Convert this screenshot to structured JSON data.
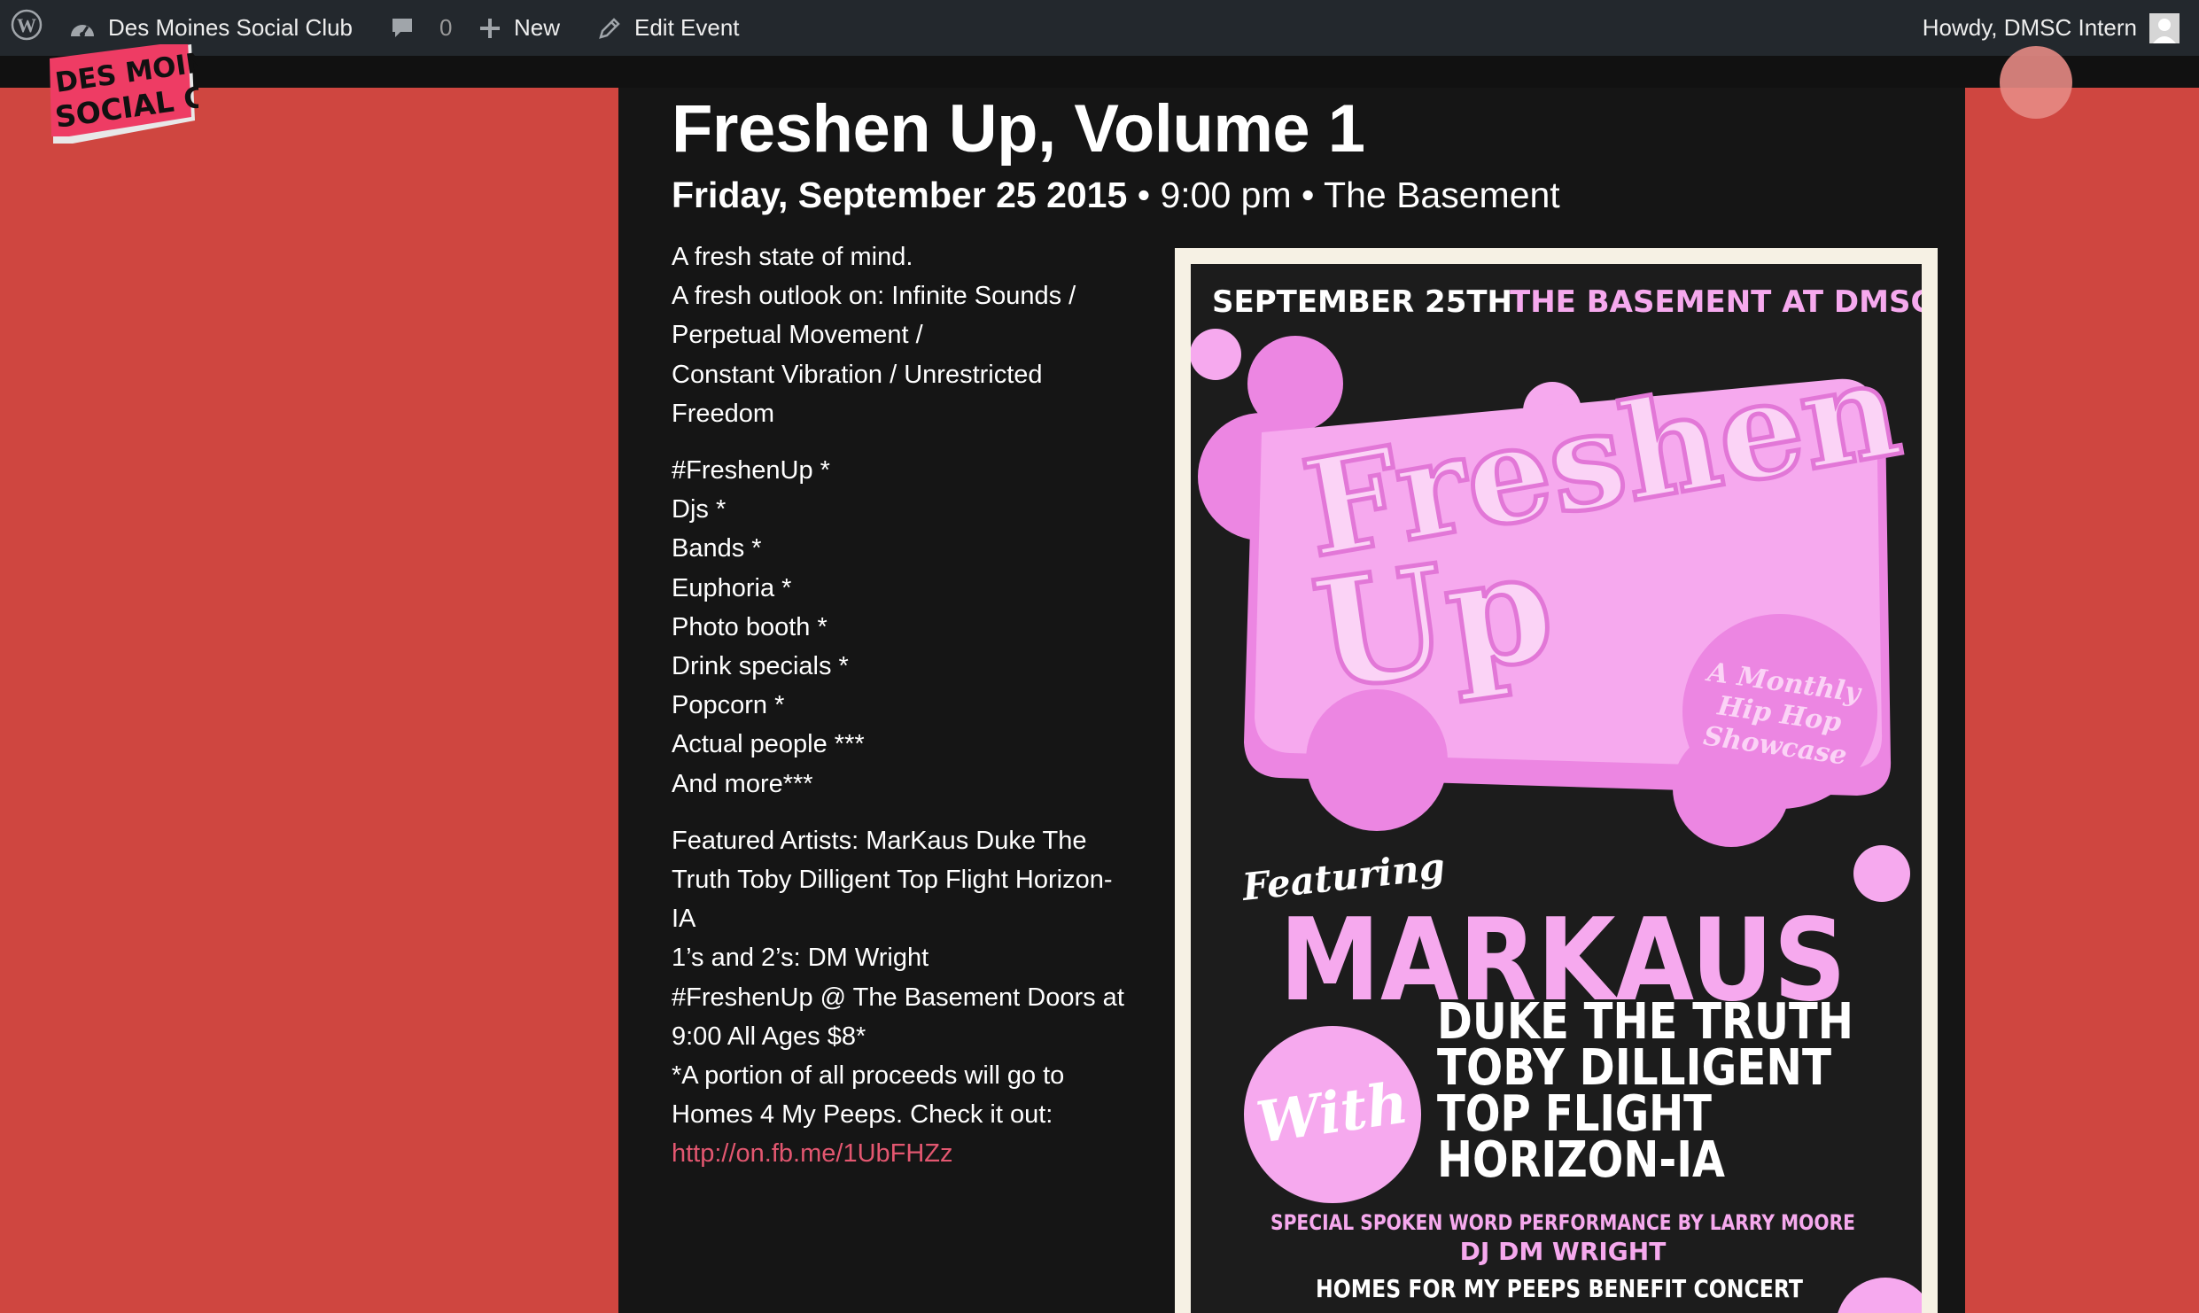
{
  "admin_bar": {
    "site_name": "Des Moines Social Club",
    "comments_count": "0",
    "new_label": "New",
    "edit_label": "Edit Event",
    "account_greeting": "Howdy, DMSC Intern",
    "icons": {
      "wp": "wordpress-logo-icon",
      "site": "dashboard-icon",
      "comments": "comment-bubble-icon",
      "new": "plus-icon",
      "edit": "pencil-icon",
      "avatar": "user-avatar-icon"
    }
  },
  "logo": {
    "line1": "DES MOINES",
    "line2": "SOCIAL CLUB"
  },
  "event": {
    "title": "Freshen Up, Volume 1",
    "date": "Friday, September 25 2015",
    "time": "9:00 pm",
    "venue": "The Basement",
    "separator": "•",
    "description": {
      "intro": [
        "A fresh state of mind.",
        "A fresh outlook on: Infinite Sounds /",
        "Perpetual Movement /",
        "Constant Vibration / Unrestricted",
        "Freedom"
      ],
      "features": [
        "#FreshenUp *",
        "Djs *",
        "Bands *",
        "Euphoria *",
        "Photo booth *",
        "Drink specials *",
        "Popcorn *",
        "Actual people ***",
        "And more***"
      ],
      "details": [
        "Featured Artists: MarKaus Duke The",
        "Truth Toby Dilligent Top Flight Horizon-",
        "IA",
        "1’s and 2’s: DM Wright",
        "#FreshenUp @ The Basement Doors at",
        "9:00 All Ages $8*",
        "*A portion of all proceeds will go to",
        "Homes 4 My Peeps. Check it out:"
      ],
      "link": "http://on.fb.me/1UbFHZz"
    }
  },
  "poster": {
    "header_date": "SEPTEMBER 25TH",
    "header_venue": "THE BASEMENT AT DMSC",
    "logo_word1": "Freshen",
    "logo_word2": "Up",
    "badge_line1": "A Monthly",
    "badge_line2": "Hip Hop",
    "badge_line3": "Showcase",
    "featuring": "Featuring",
    "headliner": "MARKAUS",
    "with": "With",
    "artists": [
      "DUKE THE TRUTH",
      "TOBY DILLIGENT",
      "TOP FLIGHT",
      "HORIZON-IA"
    ],
    "special": "SPECIAL SPOKEN WORD PERFORMANCE BY LARRY MOORE",
    "dj": "DJ DM WRIGHT",
    "benefit": "HOMES FOR MY PEEPS BENEFIT CONCERT"
  },
  "colors": {
    "background": "#cf4640",
    "panel": "#151515",
    "admin_bar": "#23282d",
    "link": "#e35770",
    "poster_pink": "#f6a9ee",
    "poster_bg": "#1c1c1c"
  }
}
